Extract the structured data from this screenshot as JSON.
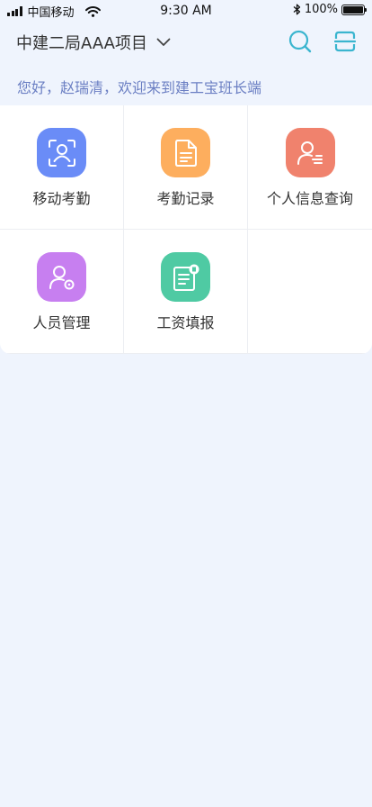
{
  "status_bar": {
    "carrier": "中国移动",
    "time": "9:30 AM",
    "battery": "100%",
    "battery_level": 1.0
  },
  "header": {
    "project_name": "中建二局AAA项目"
  },
  "greeting": "您好，赵瑞清，欢迎来到建工宝班长端",
  "menu": [
    {
      "label": "移动考勤",
      "icon": "face-scan-icon",
      "color": "#6a8cf7"
    },
    {
      "label": "考勤记录",
      "icon": "document-icon",
      "color": "#fdae5e"
    },
    {
      "label": "个人信息查询",
      "icon": "user-list-icon",
      "color": "#f0826d"
    },
    {
      "label": "人员管理",
      "icon": "user-settings-icon",
      "color": "#c77ff0"
    },
    {
      "label": "工资填报",
      "icon": "payroll-form-icon",
      "color": "#4fcaa3"
    }
  ]
}
